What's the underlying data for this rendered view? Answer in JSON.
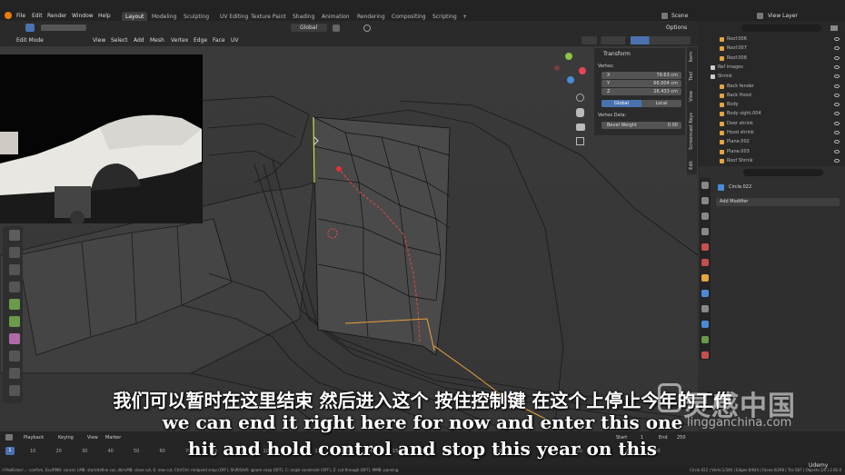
{
  "menu": [
    "File",
    "Edit",
    "Render",
    "Window",
    "Help"
  ],
  "workspaces": [
    "Layout",
    "Modeling",
    "Sculpting",
    "UV Editing",
    "Texture Paint",
    "Shading",
    "Animation",
    "Rendering",
    "Compositing",
    "Scripting"
  ],
  "add_workspace": "+",
  "scene_label": "Scene",
  "view_layer_label": "View Layer",
  "header": {
    "mode": "Edit Mode",
    "menus": [
      "View",
      "Select",
      "Add",
      "Mesh",
      "Vertex",
      "Edge",
      "Face",
      "UV"
    ],
    "orientation": "Global",
    "options": "Options"
  },
  "npanel": {
    "title": "Transform",
    "vertex_label": "Vertex:",
    "x_label": "X",
    "x_value": "79.63 cm",
    "y_label": "Y",
    "y_value": "66.004 cm",
    "z_label": "Z",
    "z_value": "26.433 cm",
    "global_btn": "Global",
    "local_btn": "Local",
    "vertex_data_label": "Vertex Data:",
    "bevel_label": "Bevel Weight",
    "bevel_value": "0.00",
    "tabs": [
      "Item",
      "Tool",
      "View",
      "Screencast Keys",
      "Edit"
    ]
  },
  "outliner": {
    "rows": [
      {
        "label": "Roof.006",
        "indent": 24,
        "color": "#e8a33d"
      },
      {
        "label": "Roof.007",
        "indent": 24,
        "color": "#e8a33d"
      },
      {
        "label": "Roof.008",
        "indent": 24,
        "color": "#e8a33d"
      },
      {
        "label": "Ref images",
        "indent": 14,
        "color": "#cccccc"
      },
      {
        "label": "Shrink",
        "indent": 14,
        "color": "#cccccc"
      },
      {
        "label": "Back fender",
        "indent": 24,
        "color": "#e8a33d"
      },
      {
        "label": "Back Hood",
        "indent": 24,
        "color": "#e8a33d"
      },
      {
        "label": "Body",
        "indent": 24,
        "color": "#e8a33d"
      },
      {
        "label": "Body sight.004",
        "indent": 24,
        "color": "#e8a33d"
      },
      {
        "label": "Door shrink",
        "indent": 24,
        "color": "#e8a33d"
      },
      {
        "label": "Hood shrink",
        "indent": 24,
        "color": "#e8a33d"
      },
      {
        "label": "Plane.002",
        "indent": 24,
        "color": "#e8a33d"
      },
      {
        "label": "Plane.003",
        "indent": 24,
        "color": "#e8a33d"
      },
      {
        "label": "Roof Shrink",
        "indent": 24,
        "color": "#e8a33d"
      }
    ]
  },
  "properties": {
    "object_name": "Circle.022",
    "add_modifier": "Add Modifier"
  },
  "timeline": {
    "menus": [
      "Playback",
      "Keying",
      "View",
      "Marker"
    ],
    "frames": [
      "10",
      "20",
      "30",
      "40",
      "50",
      "60",
      "70",
      "80",
      "90",
      "100",
      "110",
      "120",
      "130",
      "140",
      "150",
      "160",
      "170",
      "180",
      "190",
      "200",
      "210",
      "220",
      "230",
      "240",
      "250"
    ],
    "current_frame": "1",
    "start_label": "Start",
    "start_value": "1",
    "end_label": "End",
    "end_value": "250"
  },
  "statusbar": {
    "left": "rl-PadEnter/…: confirm, Esc/RMB: cancel, LMB: start/define cut, dbl-LMB: close cut, E: new cut, Ctrl/Ctrl: midpoint snap (OFF), Shift/Shift: ignore snap (OFF), C: angle constraint (OFF), Z: cut through (OFF), MMB: panning",
    "right": "Circle.022 | Verts:1/346 | Edges:0/644 | Faces:0/298 | Tris:587 | Objects:1/0 | 2.92.0"
  },
  "subtitles": {
    "zh": "我们可以暂时在这里结束 然后进入这个 按住控制键 在这个上停止今年的工作",
    "en1": "we can end it right here for now and enter this one",
    "en2": "hit and hold control and stop this year on this"
  },
  "watermark": {
    "cn": "灵感中国",
    "url": "lingganchina.com"
  },
  "udemy": "Udemy"
}
